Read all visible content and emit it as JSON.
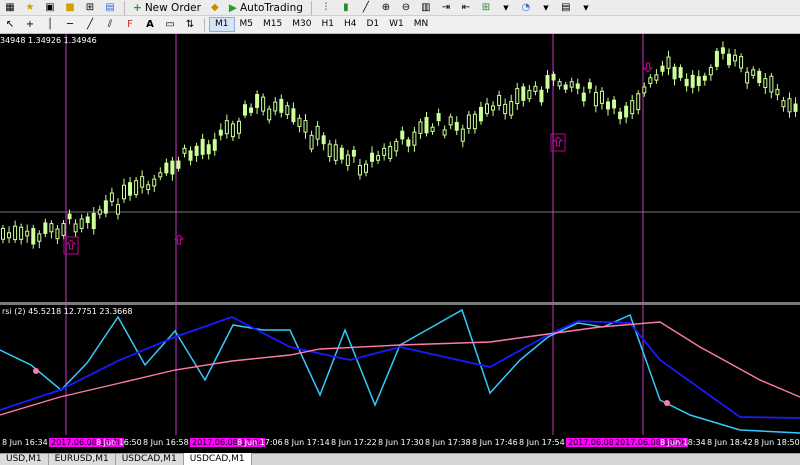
{
  "toolbar": {
    "new_order_label": "New Order",
    "autotrading_label": "AutoTrading"
  },
  "timeframes": [
    "M1",
    "M5",
    "M15",
    "M30",
    "H1",
    "H4",
    "D1",
    "W1",
    "MN"
  ],
  "active_timeframe": "M1",
  "chart": {
    "ohlc_text": "34948 1.34926 1.34946",
    "indicator_text": "rsi (2) 45.5218 12.7751 23.3668",
    "time_labels": [
      {
        "text": "8 Jun 16:34",
        "hl": false
      },
      {
        "text": "2017.06.08 16:40",
        "hl": true
      },
      {
        "text": "8 Jun 16:50",
        "hl": false
      },
      {
        "text": "8 Jun 16:58",
        "hl": false
      },
      {
        "text": "2017.06.08 17:04",
        "hl": true
      },
      {
        "text": "8 Jun 17:06",
        "hl": false
      },
      {
        "text": "8 Jun 17:14",
        "hl": false
      },
      {
        "text": "8 Jun 17:22",
        "hl": false
      },
      {
        "text": "8 Jun 17:30",
        "hl": false
      },
      {
        "text": "8 Jun 17:38",
        "hl": false
      },
      {
        "text": "8 Jun 17:46",
        "hl": false
      },
      {
        "text": "8 Jun 17:54",
        "hl": false
      },
      {
        "text": "2017.06.08 18:10",
        "hl": true
      },
      {
        "text": "2017.06.08 18:26",
        "hl": true
      },
      {
        "text": "8 Jun 18:34",
        "hl": false
      },
      {
        "text": "8 Jun 18:42",
        "hl": false
      },
      {
        "text": "8 Jun 18:50",
        "hl": false
      }
    ],
    "colors": {
      "background": "#000000",
      "candles": "#ccff99",
      "vline": "#cc33cc",
      "rsi": "#33ccff",
      "ma_fast": "#1a1aff",
      "ma_slow": "#ff7aa8",
      "marker": "#cc0099",
      "highlight": "#ff00ff"
    },
    "arrow_icon": "up-arrow-icon",
    "down_arrow_icon": "down-arrow-icon"
  },
  "tabs": [
    {
      "label": "USD,M1",
      "active": false
    },
    {
      "label": "EURUSD,M1",
      "active": false
    },
    {
      "label": "USDCAD,M1",
      "active": false
    },
    {
      "label": "USDCAD,M1",
      "active": true
    }
  ]
}
